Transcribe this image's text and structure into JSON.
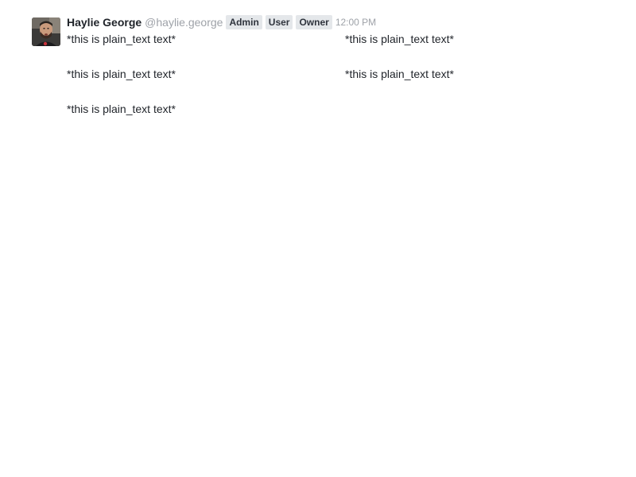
{
  "message": {
    "author": {
      "name": "Haylie George",
      "username": "@haylie.george"
    },
    "roles": [
      "Admin",
      "User",
      "Owner"
    ],
    "timestamp": "12:00 PM",
    "blocks": [
      {
        "text": "*this is plain_text text*"
      },
      {
        "text": "*this is plain_text text*"
      },
      {
        "text": "*this is plain_text text*"
      },
      {
        "text": "*this is plain_text text*"
      },
      {
        "text": "*this is plain_text text*"
      }
    ]
  },
  "colors": {
    "name": "#1f2329",
    "muted": "#9ea2a8",
    "tag_background": "#e4e7ea",
    "tag_text": "#2f343d"
  },
  "icons": {
    "avatar": "user-avatar-photo"
  }
}
